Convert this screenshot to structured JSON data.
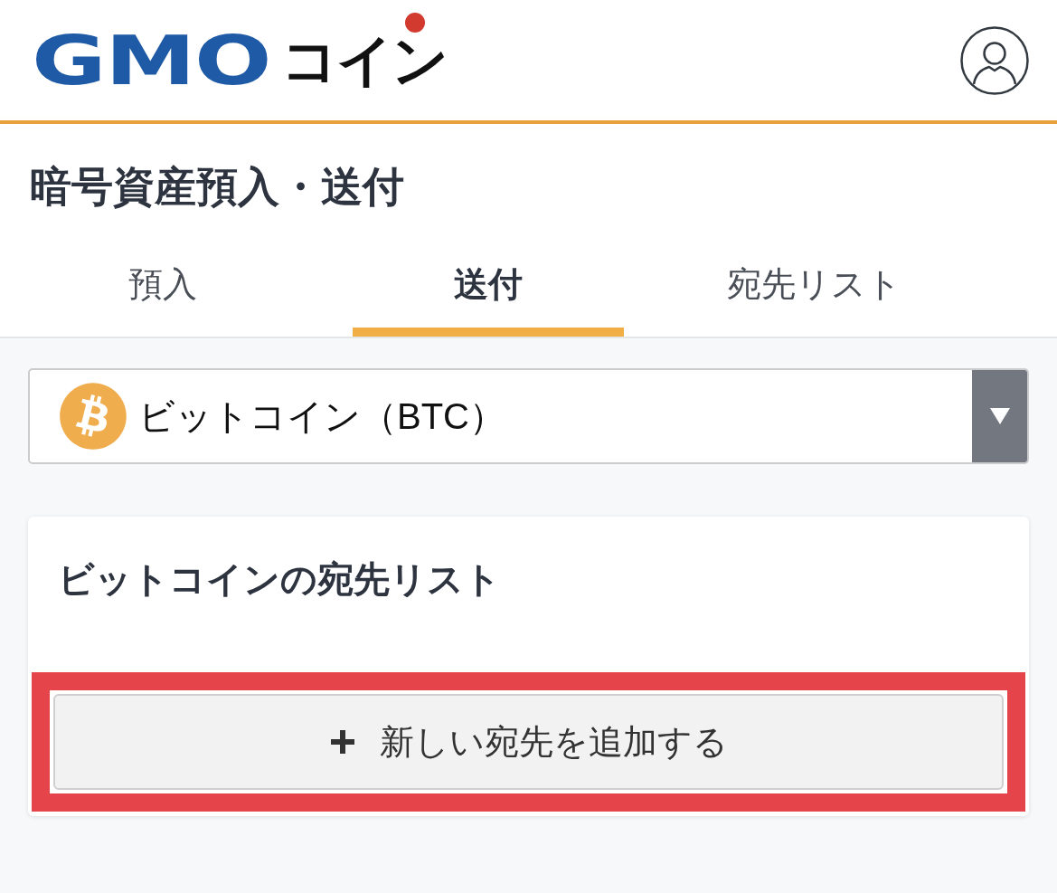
{
  "header": {
    "logo": {
      "brand": "GMO",
      "product": "コイン"
    }
  },
  "page_title": "暗号資産預入・送付",
  "tabs": [
    {
      "label": "預入",
      "selected": false
    },
    {
      "label": "送付",
      "selected": true
    },
    {
      "label": "宛先リスト",
      "selected": false
    }
  ],
  "currency_select": {
    "value": "ビットコイン（BTC）"
  },
  "address_list": {
    "title": "ビットコインの宛先リスト",
    "add_button": {
      "label": "新しい宛先を追加する",
      "highlighted": true
    }
  }
}
